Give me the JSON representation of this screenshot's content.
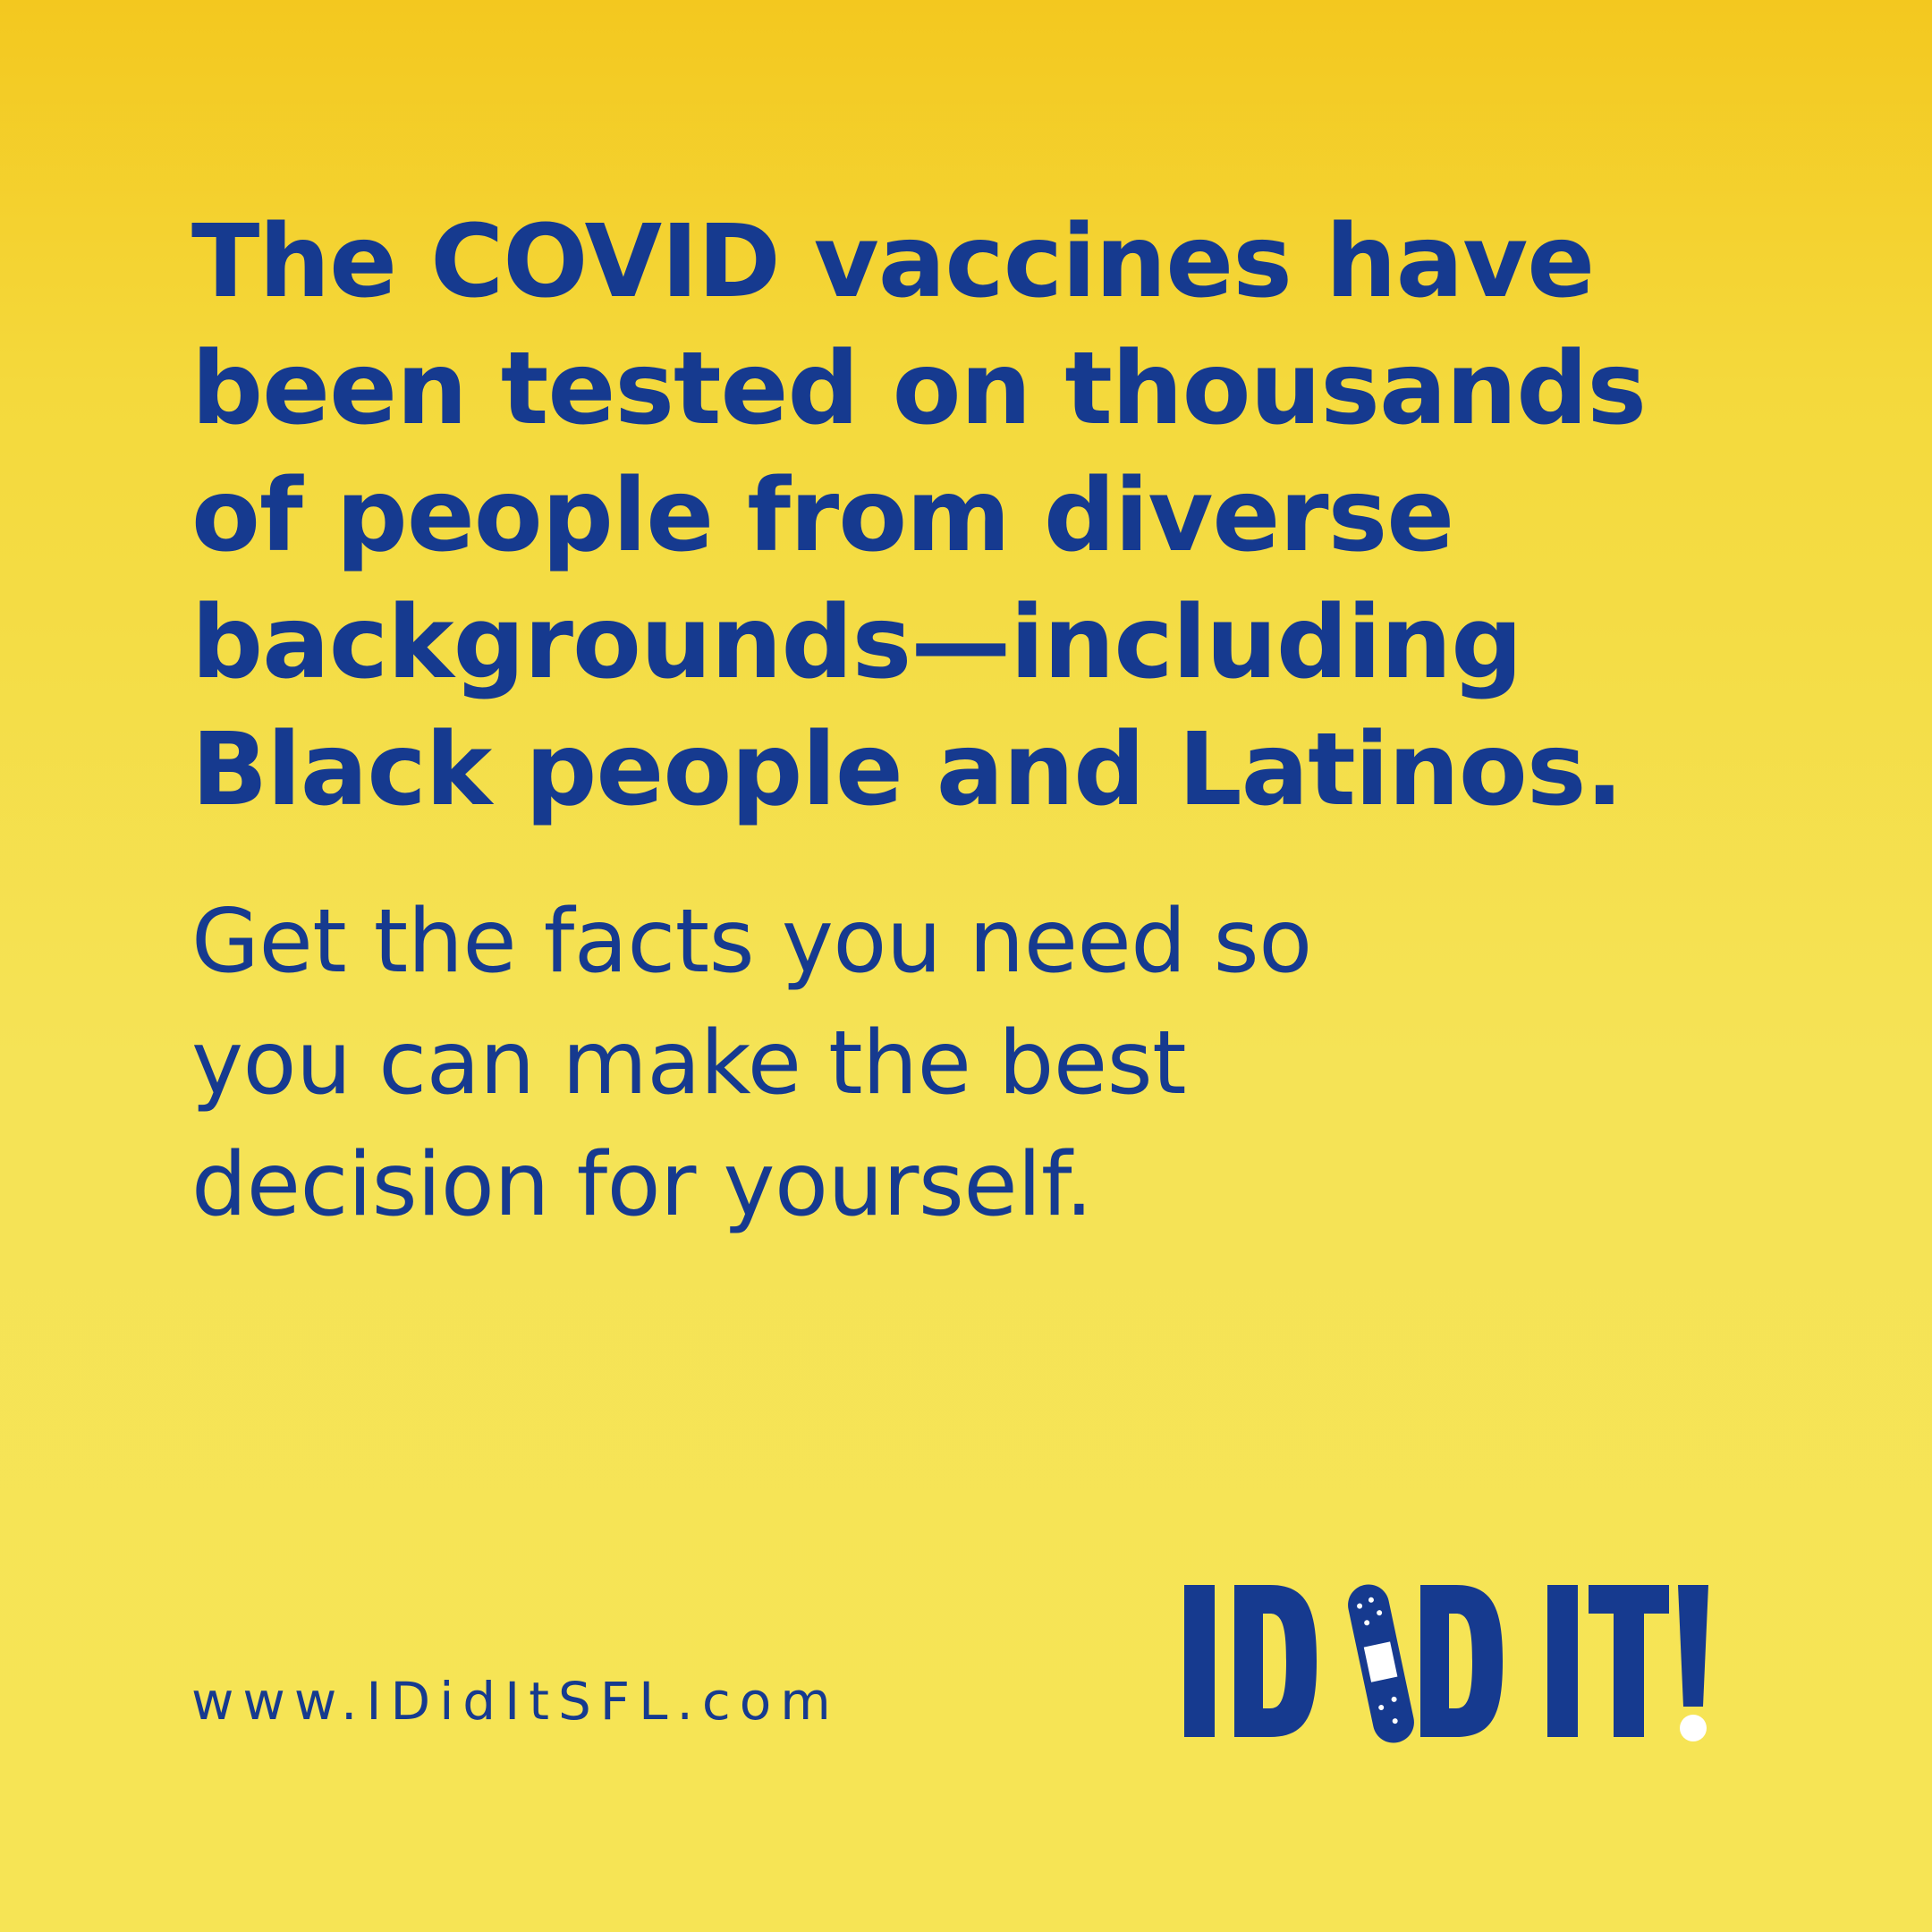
{
  "headline": {
    "lines": [
      "The COVID vaccines have",
      "been tested on thousands",
      "of people from diverse",
      "backgrounds—including",
      "Black people and Latinos."
    ]
  },
  "subhead": {
    "lines": [
      "Get the facts you need so",
      "you can make the best",
      "decision for yourself."
    ]
  },
  "footer": {
    "website": "www.IDidItSFL.com"
  },
  "logo": {
    "text": "I DID IT!",
    "icon": "bandage-icon",
    "colors": {
      "primary": "#163a8f",
      "bandage_pad": "#ffffff",
      "exclamation_dot": "#ffffff"
    }
  },
  "colors": {
    "background_top": "#f3c81f",
    "background_bottom": "#f6e455",
    "text": "#163a8f"
  }
}
